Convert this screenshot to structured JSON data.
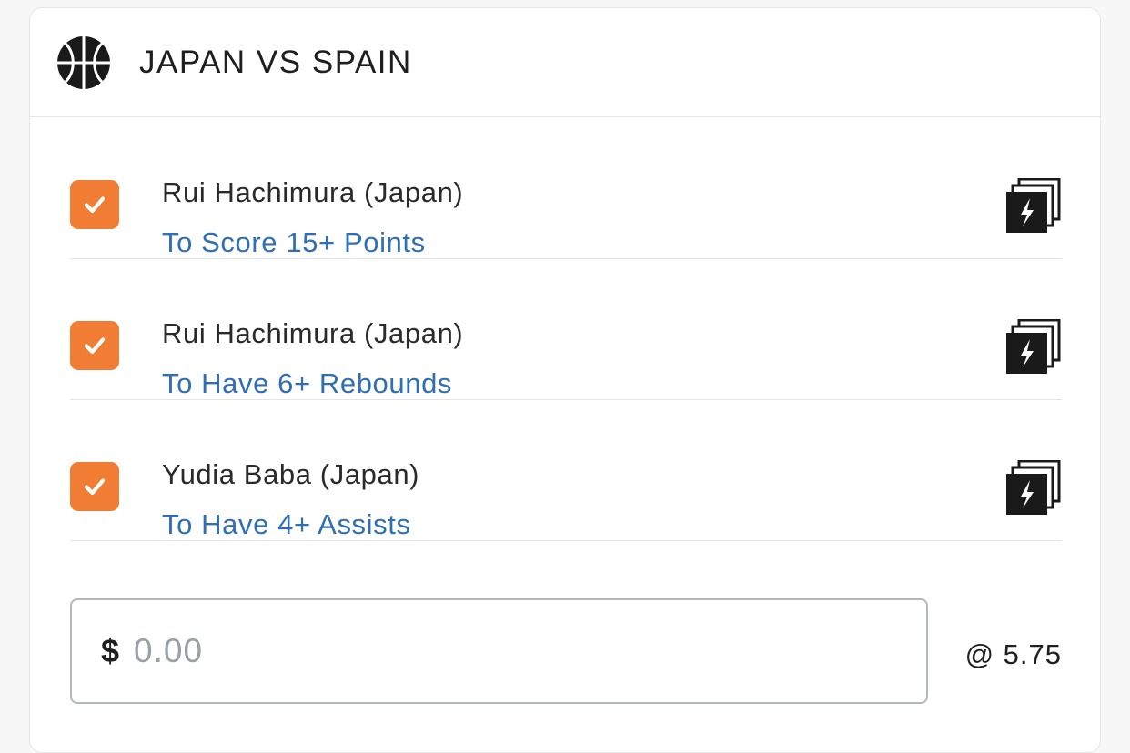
{
  "event": {
    "title": "JAPAN VS SPAIN",
    "sport_icon": "basketball-icon"
  },
  "legs": [
    {
      "player": "Rui Hachimura (Japan)",
      "market": "To Score 15+ Points",
      "checked": true,
      "icon": "boost-icon"
    },
    {
      "player": "Rui Hachimura (Japan)",
      "market": "To Have 6+ Rebounds",
      "checked": true,
      "icon": "boost-icon"
    },
    {
      "player": "Yudia Baba (Japan)",
      "market": "To Have 4+ Assists",
      "checked": true,
      "icon": "boost-icon"
    }
  ],
  "stake": {
    "currency": "$",
    "placeholder": "0.00",
    "value": ""
  },
  "odds": "@ 5.75",
  "colors": {
    "checkbox": "#f07d33",
    "market_text": "#2f6fb5",
    "title_text": "#1f1f1f"
  }
}
